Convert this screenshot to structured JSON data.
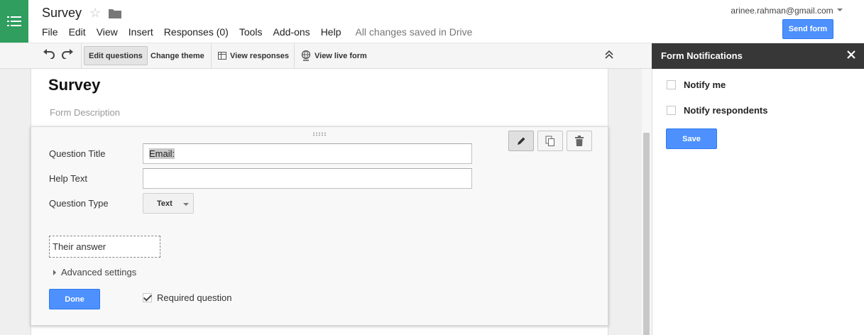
{
  "header": {
    "doc_title": "Survey",
    "menu": [
      "File",
      "Edit",
      "View",
      "Insert",
      "Responses (0)",
      "Tools",
      "Add-ons",
      "Help"
    ],
    "save_status": "All changes saved in Drive",
    "account": "arinee.rahman@gmail.com",
    "send_label": "Send form"
  },
  "toolbar": {
    "edit_questions": "Edit questions",
    "change_theme": "Change theme",
    "view_responses": "View responses",
    "view_live_form": "View live form"
  },
  "form": {
    "title": "Survey",
    "description_placeholder": "Form Description"
  },
  "question": {
    "title_label": "Question Title",
    "title_value": "Email:",
    "help_label": "Help Text",
    "help_value": "",
    "type_label": "Question Type",
    "type_value": "Text",
    "answer_preview": "Their answer",
    "advanced": "Advanced settings",
    "done_label": "Done",
    "required_label": "Required question",
    "required_checked": true
  },
  "panel": {
    "title": "Form Notifications",
    "notify_me": "Notify me",
    "notify_respondents": "Notify respondents",
    "save_label": "Save"
  },
  "colors": {
    "brand_green": "#2f9e5f",
    "primary_blue": "#4d90fe",
    "panel_header": "#373737"
  }
}
